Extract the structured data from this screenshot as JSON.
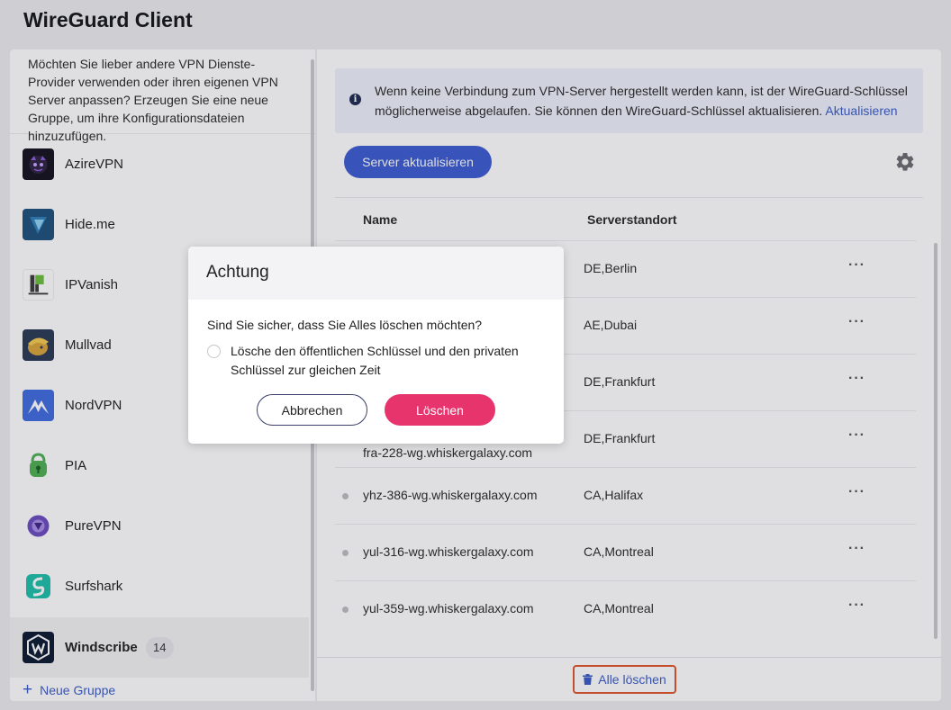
{
  "app": {
    "title": "WireGuard Client"
  },
  "sidebar": {
    "hint": "Möchten Sie lieber andere VPN Dienste-Provider verwenden oder ihren eigenen VPN Server anpassen? Erzeugen Sie eine neue Gruppe, um ihre Konfigurationsdateien hinzuzufügen.",
    "items": [
      {
        "label": "AzireVPN",
        "icon": "azirevpn-logo-icon",
        "color": "#15111f"
      },
      {
        "label": "Hide.me",
        "icon": "hideme-logo-icon",
        "color": "#1d4f7c"
      },
      {
        "label": "IPVanish",
        "icon": "ipvanish-logo-icon",
        "color": "#6bbf3b"
      },
      {
        "label": "Mullvad",
        "icon": "mullvad-logo-icon",
        "color": "#2a3954"
      },
      {
        "label": "NordVPN",
        "icon": "nordvpn-logo-icon",
        "color": "#3f6be0"
      },
      {
        "label": "PIA",
        "icon": "pia-logo-icon",
        "color": "#4caf50"
      },
      {
        "label": "PureVPN",
        "icon": "purevpn-logo-icon",
        "color": "#6a4cc0"
      },
      {
        "label": "Surfshark",
        "icon": "surfshark-logo-icon",
        "color": "#1dbfa8"
      },
      {
        "label": "Windscribe",
        "icon": "windscribe-logo-icon",
        "color": "#0b1930",
        "count": "14",
        "active": true
      }
    ],
    "new_group": "Neue Gruppe"
  },
  "notice": {
    "text": "Wenn keine Verbindung zum VPN-Server hergestellt werden kann, ist der WireGuard-Schlüssel möglicherweise abgelaufen. Sie können den WireGuard-Schlüssel aktualisieren.",
    "link": "Aktualisieren"
  },
  "toolbar": {
    "update_label": "Server aktualisieren"
  },
  "table": {
    "headers": {
      "name": "Name",
      "location": "Serverstandort"
    },
    "rows": [
      {
        "name": "",
        "location": "DE,Berlin"
      },
      {
        "name": "",
        "location": "AE,Dubai"
      },
      {
        "name": "",
        "location": "DE,Frankfurt"
      },
      {
        "name": "fra-228-wg.whiskergalaxy.com",
        "location": "DE,Frankfurt"
      },
      {
        "name": "yhz-386-wg.whiskergalaxy.com",
        "location": "CA,Halifax"
      },
      {
        "name": "yul-316-wg.whiskergalaxy.com",
        "location": "CA,Montreal"
      },
      {
        "name": "yul-359-wg.whiskergalaxy.com",
        "location": "CA,Montreal"
      }
    ],
    "more": "···"
  },
  "footer": {
    "delete_all": "Alle löschen"
  },
  "dialog": {
    "title": "Achtung",
    "question": "Sind Sie sicher, dass Sie Alles löschen möchten?",
    "option": "Lösche den öffentlichen Schlüssel und den privaten Schlüssel zur gleichen Zeit",
    "cancel": "Abbrechen",
    "confirm": "Löschen"
  },
  "colors": {
    "primary": "#3b5bd0",
    "danger": "#e8346c",
    "link": "#3a5bc7",
    "highlight": "#e0552a"
  }
}
